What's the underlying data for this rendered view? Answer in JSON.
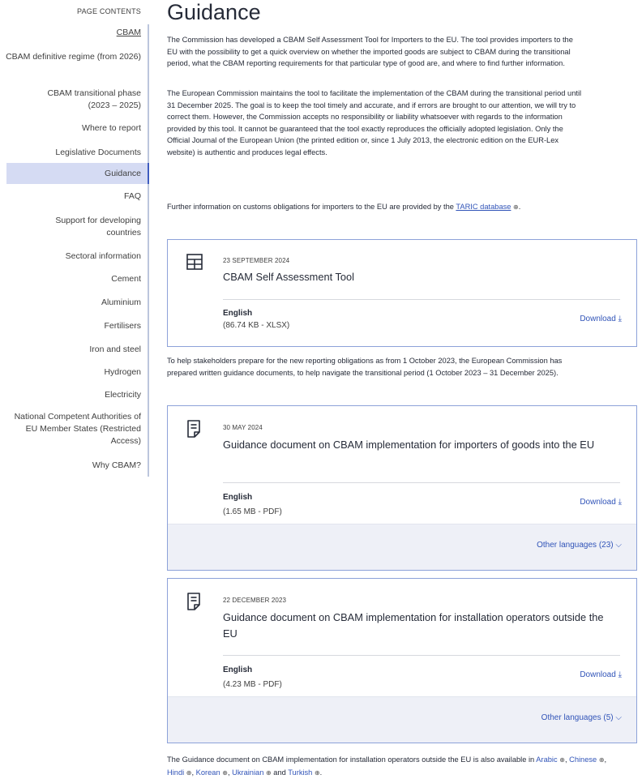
{
  "nav": {
    "title": "PAGE CONTENTS",
    "items": [
      {
        "label": "CBAM"
      },
      {
        "label": "CBAM definitive regime (from 2026)"
      },
      {
        "label": "CBAM transitional phase (2023 – 2025)"
      },
      {
        "label": "Where to report"
      },
      {
        "label": "Legislative Documents"
      },
      {
        "label": "Guidance"
      },
      {
        "label": "FAQ"
      },
      {
        "label": "Support for developing countries"
      },
      {
        "label": "Sectoral information"
      },
      {
        "label": "Cement"
      },
      {
        "label": "Aluminium"
      },
      {
        "label": "Fertilisers"
      },
      {
        "label": "Iron and steel"
      },
      {
        "label": "Hydrogen"
      },
      {
        "label": "Electricity"
      },
      {
        "label": "National Competent Authorities of EU Member States (Restricted Access)"
      },
      {
        "label": "Why CBAM?"
      }
    ],
    "active": "Guidance"
  },
  "page": {
    "title": "Guidance",
    "intro1": "The Commission has developed a CBAM Self Assessment Tool for Importers to the EU. The tool provides importers to the EU with the possibility to get a quick overview on whether the imported goods are subject to CBAM during the transitional period, what the CBAM reporting requirements for that particular type of good are, and where to find further information.",
    "intro2": "The European Commission maintains the tool to facilitate the implementation of the CBAM during the transitional period until 31 December 2025. The goal is to keep the tool timely and accurate, and if errors are brought to our attention, we will try to correct them. However, the Commission accepts no responsibility or liability whatsoever with regards to the information provided by this tool. It cannot be guaranteed that the tool exactly reproduces the officially adopted legislation. Only the Official Journal of the European Union (the printed edition or, since 1 July 2013, the electronic edition on the EUR-Lex website) is authentic and produces legal effects.",
    "intro3_prefix": "Further information on customs obligations for importers to the EU are provided by the ",
    "intro3_link": "TARIC database",
    "intro3_suffix": ".",
    "between": "To help stakeholders prepare for the new reporting obligations as from 1 October 2023, the European Commission has prepared written guidance documents, to help navigate the transitional period (1 October 2023 – 31 December 2025).",
    "closing_prefix": "The Guidance document on CBAM implementation for installation operators outside the EU is also available in ",
    "closing_languages": [
      "Arabic",
      "Chinese",
      "Hindi",
      "Korean",
      "Ukrainian",
      "Turkish"
    ],
    "closing_and": "and",
    "closing_suffix": "."
  },
  "cards": [
    {
      "date": "23 SEPTEMBER 2024",
      "title": "CBAM Self Assessment Tool",
      "language": "English",
      "meta": "(86.74 KB - XLSX)",
      "download": "Download",
      "icon": "table-icon"
    },
    {
      "date": "30 MAY 2024",
      "title": "Guidance document on CBAM implementation for importers of goods into the EU",
      "language": "English",
      "meta": "(1.65 MB - PDF)",
      "download": "Download",
      "other": "Other languages (23)",
      "icon": "document-icon"
    },
    {
      "date": "22 DECEMBER 2023",
      "title": "Guidance document on CBAM implementation for installation operators outside the EU",
      "language": "English",
      "meta": "(4.23 MB - PDF)",
      "download": "Download",
      "other": "Other languages (5)",
      "icon": "document-icon"
    }
  ],
  "colors": {
    "accent": "#3154b8",
    "active_bg": "#d5dbf3",
    "card_border": "#8da2d9",
    "footer_bg": "#eef0f7"
  }
}
